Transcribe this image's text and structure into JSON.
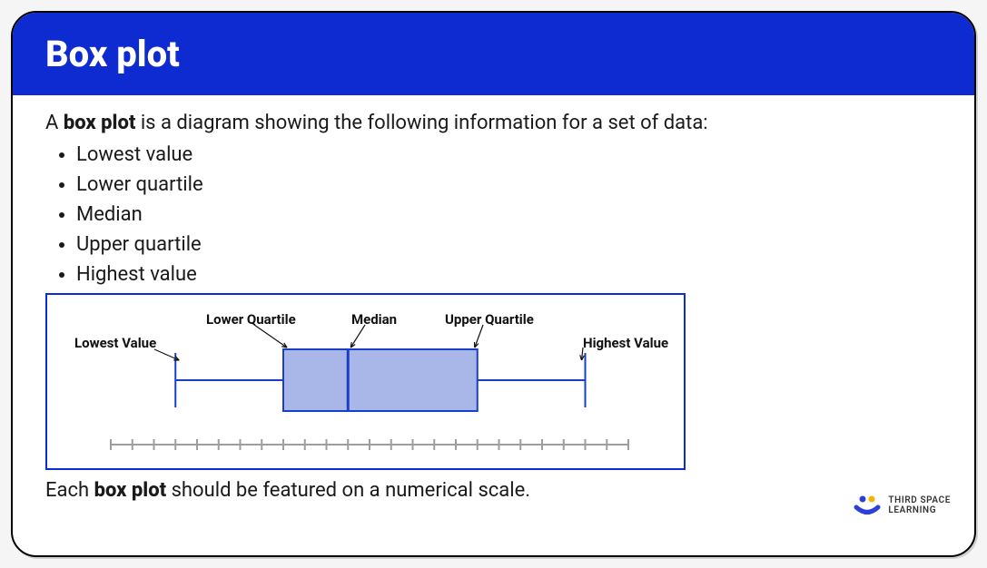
{
  "page_title": "Box plot",
  "intro_before": "A ",
  "intro_bold": "box plot",
  "intro_after": " is a diagram showing the following information for a set of data:",
  "items": [
    "Lowest value",
    "Lower quartile",
    "Median",
    "Upper quartile",
    "Highest value"
  ],
  "outro_before": "Each ",
  "outro_bold": "box plot",
  "outro_after": " should be featured on a numerical scale.",
  "diagram_labels": {
    "lowest": "Lowest Value",
    "lower_q": "Lower Quartile",
    "median": "Median",
    "upper_q": "Upper Quartile",
    "highest": "Highest Value"
  },
  "brand": {
    "line1": "THIRD SPACE",
    "line2": "LEARNING"
  },
  "chart_data": {
    "type": "boxplot",
    "title": "Box plot",
    "xlabel": "",
    "ylabel": "",
    "axis": {
      "ticks": 25,
      "range": [
        0,
        24
      ]
    },
    "summary": {
      "lowest": 3,
      "lower_quartile": 8,
      "median": 11,
      "upper_quartile": 17,
      "highest": 22
    },
    "labels": [
      "Lowest Value",
      "Lower Quartile",
      "Median",
      "Upper Quartile",
      "Highest Value"
    ]
  }
}
